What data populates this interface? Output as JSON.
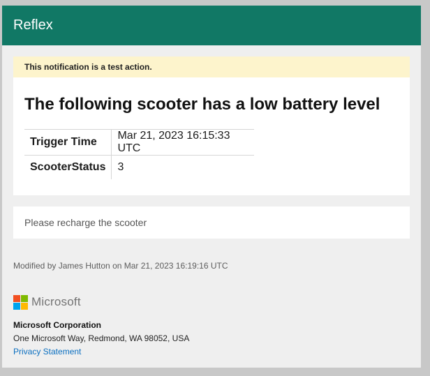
{
  "header": {
    "title": "Reflex",
    "background_color": "#117865"
  },
  "notice": {
    "banner_text": "This notification is a test action.",
    "banner_color": "#fdf4cc",
    "headline": "The following scooter has a low battery level",
    "details": [
      {
        "key": "Trigger Time",
        "value": "Mar 21, 2023 16:15:33 UTC"
      },
      {
        "key": "ScooterStatus",
        "value": "3"
      }
    ]
  },
  "message": {
    "text": "Please recharge the scooter"
  },
  "footer": {
    "modified_text": "Modified by James Hutton on Mar 21, 2023 16:19:16 UTC",
    "logo": {
      "icon": "microsoft-logo-icon",
      "wordmark": "Microsoft",
      "colors": [
        "#f25022",
        "#7fba00",
        "#00a4ef",
        "#ffb900"
      ]
    },
    "company_name": "Microsoft Corporation",
    "address": "One Microsoft Way, Redmond, WA 98052, USA",
    "privacy_link": "Privacy Statement",
    "link_color": "#0b6fc0"
  }
}
